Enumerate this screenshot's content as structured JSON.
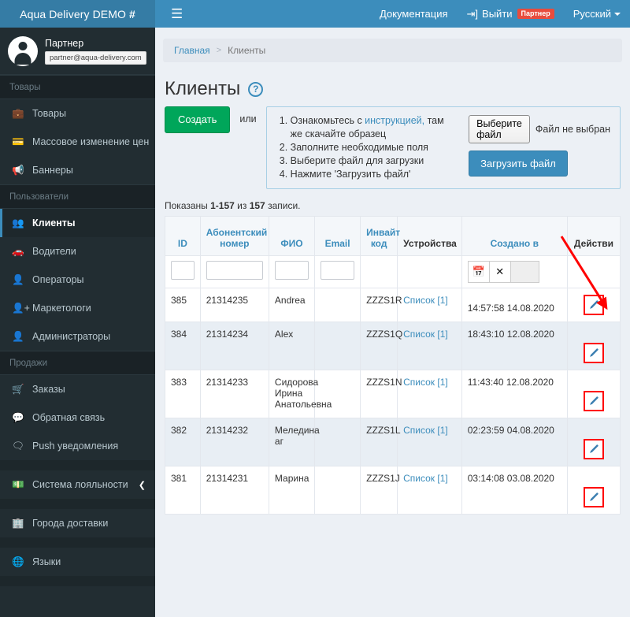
{
  "navbar": {
    "brand": "Aqua Delivery DEMO",
    "brand_hash": "#",
    "menu_toggle_icon": "hamburger-icon",
    "docs_label": "Документация",
    "logout_label": "Выйти",
    "logout_icon": "sign-out-icon",
    "role_badge": "Партнер",
    "language_label": "Русский"
  },
  "sidebar": {
    "user": {
      "name": "Партнер",
      "email": "partner@aqua-delivery.com",
      "avatar_icon": "user-circle-icon"
    },
    "sections": [
      {
        "header": "Товары",
        "items": [
          {
            "label": "Товары",
            "icon": "briefcase-icon",
            "active": false
          },
          {
            "label": "Массовое изменение цен",
            "icon": "credit-card-icon",
            "active": false
          },
          {
            "label": "Баннеры",
            "icon": "bullhorn-icon",
            "active": false
          }
        ]
      },
      {
        "header": "Пользователи",
        "items": [
          {
            "label": "Клиенты",
            "icon": "users-icon",
            "active": true
          },
          {
            "label": "Водители",
            "icon": "car-icon",
            "active": false
          },
          {
            "label": "Операторы",
            "icon": "user-icon",
            "active": false
          },
          {
            "label": "Маркетологи",
            "icon": "user-plus-icon",
            "active": false
          },
          {
            "label": "Администраторы",
            "icon": "user-icon",
            "active": false
          }
        ]
      },
      {
        "header": "Продажи",
        "items": [
          {
            "label": "Заказы",
            "icon": "shopping-basket-icon",
            "active": false
          },
          {
            "label": "Обратная связь",
            "icon": "comments-icon",
            "active": false
          },
          {
            "label": "Push уведомления",
            "icon": "comment-icon",
            "active": false
          }
        ]
      },
      {
        "header": "",
        "items": [
          {
            "label": "Система лояльности",
            "icon": "money-icon",
            "active": false,
            "arrow_icon": "chevron-left-icon"
          }
        ]
      },
      {
        "header": "",
        "items": [
          {
            "label": "Города доставки",
            "icon": "city-icon",
            "active": false
          }
        ]
      },
      {
        "header": "",
        "items": [
          {
            "label": "Языки",
            "icon": "language-icon",
            "active": false
          }
        ]
      }
    ]
  },
  "breadcrumb": {
    "home": "Главная",
    "separator": ">",
    "current": "Клиенты"
  },
  "page": {
    "title": "Клиенты",
    "help_icon": "question-circle-icon",
    "create_button": "Создать",
    "or_label": "или",
    "import": {
      "steps": [
        {
          "prefix": "Ознакомьтесь с ",
          "link": "инструкцией,",
          "suffix": " там же скачайте образец"
        },
        {
          "prefix": "Заполните необходимые поля",
          "link": "",
          "suffix": ""
        },
        {
          "prefix": "Выберите файл для загрузки",
          "link": "",
          "suffix": ""
        },
        {
          "prefix": "Нажмите 'Загрузить файл'",
          "link": "",
          "suffix": ""
        }
      ],
      "file_button": "Выберите файл",
      "file_status": "Файл не выбран",
      "upload_button": "Загрузить файл"
    },
    "summary": {
      "prefix": "Показаны ",
      "range": "1-157",
      "middle": " из ",
      "total": "157",
      "suffix": " записи."
    }
  },
  "table": {
    "columns": [
      {
        "label": "ID",
        "sortable": true
      },
      {
        "label": "Абонентский номер",
        "sortable": true
      },
      {
        "label": "ФИО",
        "sortable": true
      },
      {
        "label": "Email",
        "sortable": true
      },
      {
        "label": "Инвайт код",
        "sortable": true
      },
      {
        "label": "Устройства",
        "sortable": false
      },
      {
        "label": "Создано в",
        "sortable": true
      },
      {
        "label": "Действи",
        "sortable": false
      }
    ],
    "filters": {
      "id_value": "",
      "number_value": "",
      "fio_value": "",
      "email_value": "",
      "date_value": "",
      "calendar_icon": "calendar-icon",
      "clear_icon": "times-icon"
    },
    "rows": [
      {
        "id": "385",
        "number": "21314235",
        "fio": "Andrea",
        "email": "",
        "invite": "ZZZS1R",
        "devices": "Список [1]",
        "created": "14:57:58 14.08.2020",
        "action_icon": "pencil-icon",
        "highlighted": true
      },
      {
        "id": "384",
        "number": "21314234",
        "fio": "Alex",
        "email": "",
        "invite": "ZZZS1Q",
        "devices": "Список [1]",
        "created": "18:43:10 12.08.2020",
        "action_icon": "pencil-icon",
        "highlighted": true
      },
      {
        "id": "383",
        "number": "21314233",
        "fio": "Сидорова Ирина Анатольевна",
        "email": "",
        "invite": "ZZZS1N",
        "devices": "Список [1]",
        "created": "11:43:40 12.08.2020",
        "action_icon": "pencil-icon",
        "highlighted": true
      },
      {
        "id": "382",
        "number": "21314232",
        "fio": "Меледина аг",
        "email": "",
        "invite": "ZZZS1L",
        "devices": "Список [1]",
        "created": "02:23:59 04.08.2020",
        "action_icon": "pencil-icon",
        "highlighted": true
      },
      {
        "id": "381",
        "number": "21314231",
        "fio": "Марина",
        "email": "",
        "invite": "ZZZS1J",
        "devices": "Список [1]",
        "created": "03:14:08 03.08.2020",
        "action_icon": "pencil-icon",
        "highlighted": true
      }
    ]
  },
  "annotation": {
    "arrow_color": "#ff0000",
    "highlight_color": "#ff0000"
  },
  "colors": {
    "navbar": "#3c8dbc",
    "brand": "#357ca5",
    "sidebar": "#222d32",
    "accent": "#3c8dbc",
    "success": "#00a65a",
    "danger": "#e84c3d",
    "body": "#ecf0f5"
  }
}
